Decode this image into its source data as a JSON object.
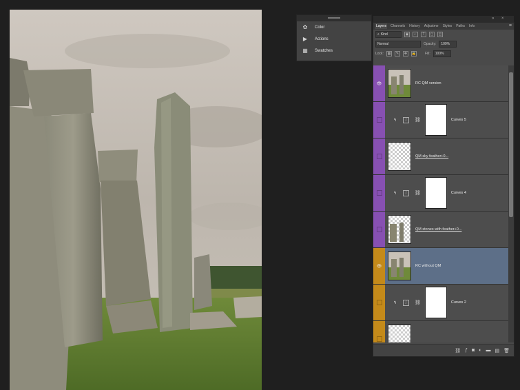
{
  "mini_panel": {
    "items": [
      {
        "label": "Color",
        "icon": "color-wheel-icon"
      },
      {
        "label": "Actions",
        "icon": "play-icon"
      },
      {
        "label": "Swatches",
        "icon": "swatches-icon"
      }
    ]
  },
  "layers_panel": {
    "tabs": [
      "Layers",
      "Channels",
      "History",
      "Adjustme",
      "Styles",
      "Paths",
      "Info"
    ],
    "active_tab": "Layers",
    "filter": "Kind",
    "blend_mode": "Normal",
    "opacity_label": "Opacity:",
    "opacity_value": "100%",
    "lock_label": "Lock:",
    "fill_label": "Fill:",
    "fill_value": "100%",
    "layers": [
      {
        "name": "RC QM version",
        "type": "group",
        "color": "purple",
        "selected": false
      },
      {
        "name": "Curves 5",
        "type": "adjustment",
        "color": "purple",
        "selected": false
      },
      {
        "name": "QM sky feather+0...",
        "type": "image",
        "color": "purple",
        "selected": false
      },
      {
        "name": "Curves 4",
        "type": "adjustment",
        "color": "purple",
        "selected": false
      },
      {
        "name": "QM stones with feather+0...",
        "type": "image",
        "color": "purple",
        "selected": false
      },
      {
        "name": "RC without QM",
        "type": "image",
        "color": "gold",
        "selected": true
      },
      {
        "name": "Curves 2",
        "type": "adjustment",
        "color": "gold",
        "selected": false
      },
      {
        "name": "",
        "type": "image",
        "color": "gold",
        "selected": false
      }
    ],
    "colors": {
      "purple": "#8750b2",
      "gold": "#c48a1a",
      "selected": "#5d6f88"
    }
  }
}
